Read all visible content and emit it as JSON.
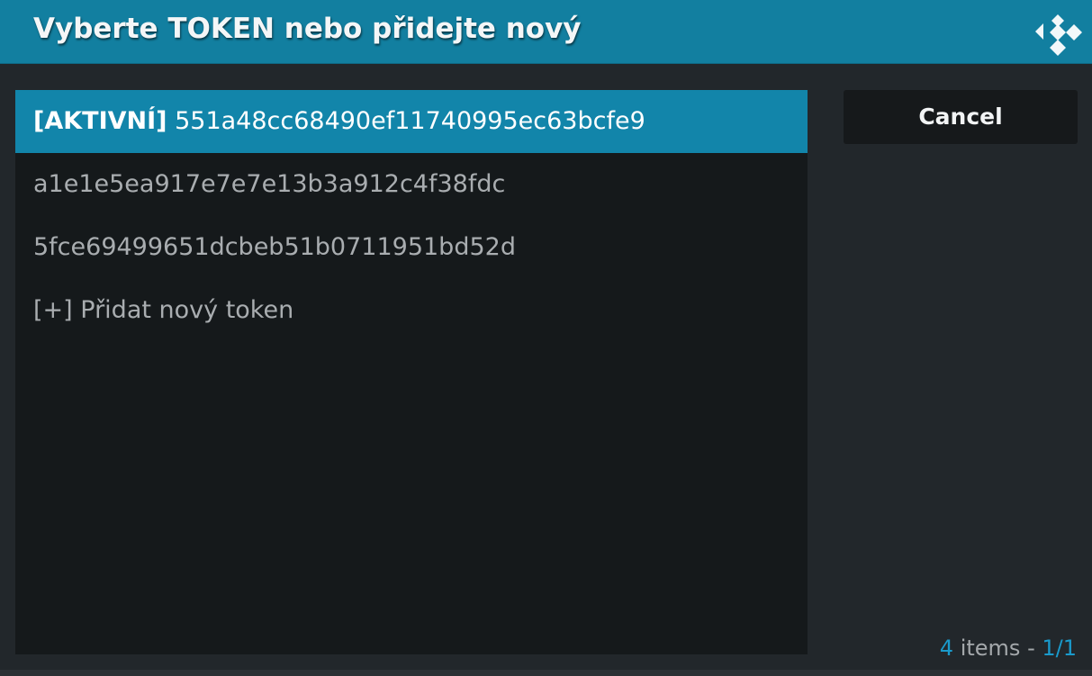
{
  "header": {
    "title": "Vyberte TOKEN nebo přidejte nový",
    "logo_icon": "kodi-logo-icon"
  },
  "tokens": {
    "items": [
      {
        "prefix": "[AKTIVNÍ]",
        "label": "551a48cc68490ef11740995ec63bcfe9",
        "selected": true
      },
      {
        "prefix": "",
        "label": "a1e1e5ea917e7e7e13b3a912c4f38fdc",
        "selected": false
      },
      {
        "prefix": "",
        "label": "5fce69499651dcbeb51b0711951bd52d",
        "selected": false
      },
      {
        "prefix": "",
        "label": "[+] Přidat nový token",
        "selected": false
      }
    ]
  },
  "cancel": {
    "label": "Cancel"
  },
  "footer": {
    "count": "4",
    "items_word": "items",
    "separator": "-",
    "page": "1/1"
  },
  "colors": {
    "header": "#127fa0",
    "selected": "#1285aa",
    "accent_text": "#1a9acb"
  }
}
